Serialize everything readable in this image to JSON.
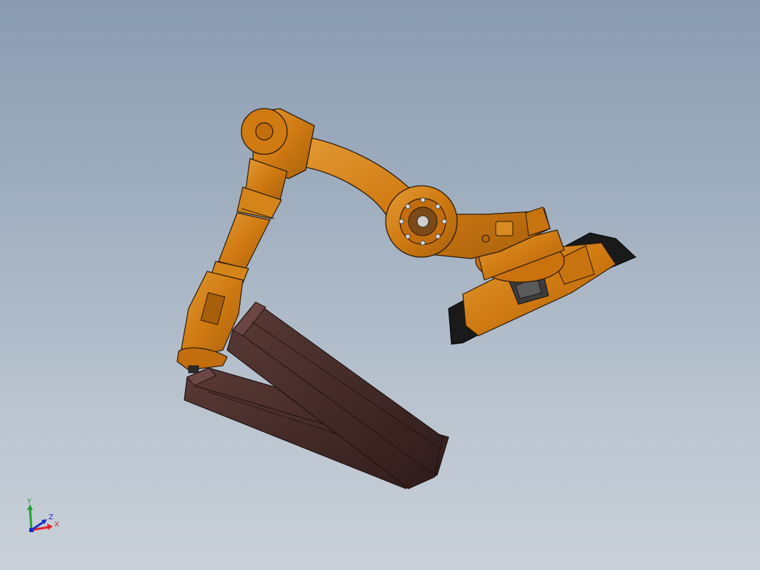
{
  "viewport": {
    "background_top": "#8a9cb1",
    "background_bottom": "#c9d0d8"
  },
  "model": {
    "parts": [
      "robot-base",
      "base-turntable",
      "upper-arm",
      "forearm",
      "wrist",
      "gripper",
      "workpiece-beam-upper",
      "workpiece-beam-lower"
    ],
    "colors": {
      "arm": "#d07a12",
      "arm_shade": "#9a560a",
      "arm_highlight": "#e39a35",
      "base_plate": "#1a1a1a",
      "beam": "#3a2422",
      "beam_light": "#5a3a36",
      "edge": "#2a1a08"
    }
  },
  "triad": {
    "x_label": "X",
    "y_label": "Y",
    "z_label": "Z",
    "x_color": "#e0242a",
    "y_color": "#1ea12e",
    "z_color": "#1c2fc4"
  }
}
